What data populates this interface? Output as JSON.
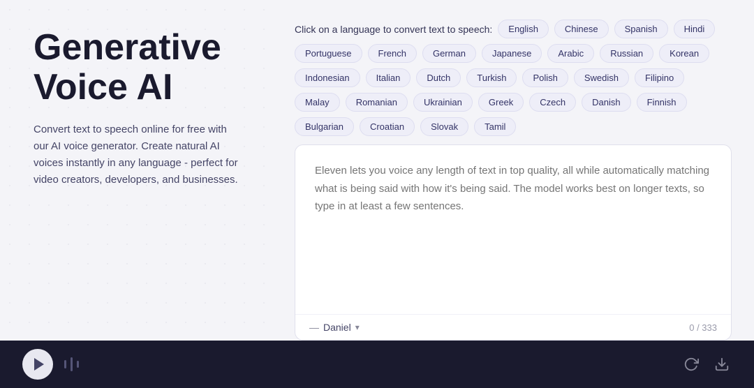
{
  "left": {
    "title_line1": "Generative",
    "title_line2": "Voice AI",
    "description": "Convert text to speech online for free with our AI voice generator. Create natural AI voices instantly in any language - perfect for video creators, developers, and businesses."
  },
  "right": {
    "prompt": "Click on a language to convert text to speech:",
    "languages": [
      {
        "label": "English",
        "active": false
      },
      {
        "label": "Chinese",
        "active": false
      },
      {
        "label": "Spanish",
        "active": false
      },
      {
        "label": "Hindi",
        "active": false
      },
      {
        "label": "Portuguese",
        "active": false
      },
      {
        "label": "French",
        "active": false
      },
      {
        "label": "German",
        "active": false
      },
      {
        "label": "Japanese",
        "active": false
      },
      {
        "label": "Arabic",
        "active": false
      },
      {
        "label": "Russian",
        "active": false
      },
      {
        "label": "Korean",
        "active": false
      },
      {
        "label": "Indonesian",
        "active": false
      },
      {
        "label": "Italian",
        "active": false
      },
      {
        "label": "Dutch",
        "active": false
      },
      {
        "label": "Turkish",
        "active": false
      },
      {
        "label": "Polish",
        "active": false
      },
      {
        "label": "Swedish",
        "active": false
      },
      {
        "label": "Filipino",
        "active": false
      },
      {
        "label": "Malay",
        "active": false
      },
      {
        "label": "Romanian",
        "active": false
      },
      {
        "label": "Ukrainian",
        "active": false
      },
      {
        "label": "Greek",
        "active": false
      },
      {
        "label": "Czech",
        "active": false
      },
      {
        "label": "Danish",
        "active": false
      },
      {
        "label": "Finnish",
        "active": false
      },
      {
        "label": "Bulgarian",
        "active": false
      },
      {
        "label": "Croatian",
        "active": false
      },
      {
        "label": "Slovak",
        "active": false
      },
      {
        "label": "Tamil",
        "active": false
      }
    ],
    "textarea_placeholder": "Eleven lets you voice any length of text in top quality, all while automatically matching what is being said with how it's being said. The model works best on longer texts, so type in at least a few sentences.",
    "voice_dash": "—",
    "voice_name": "Daniel",
    "char_count": "0 / 333"
  },
  "playback": {
    "play_label": "play"
  }
}
